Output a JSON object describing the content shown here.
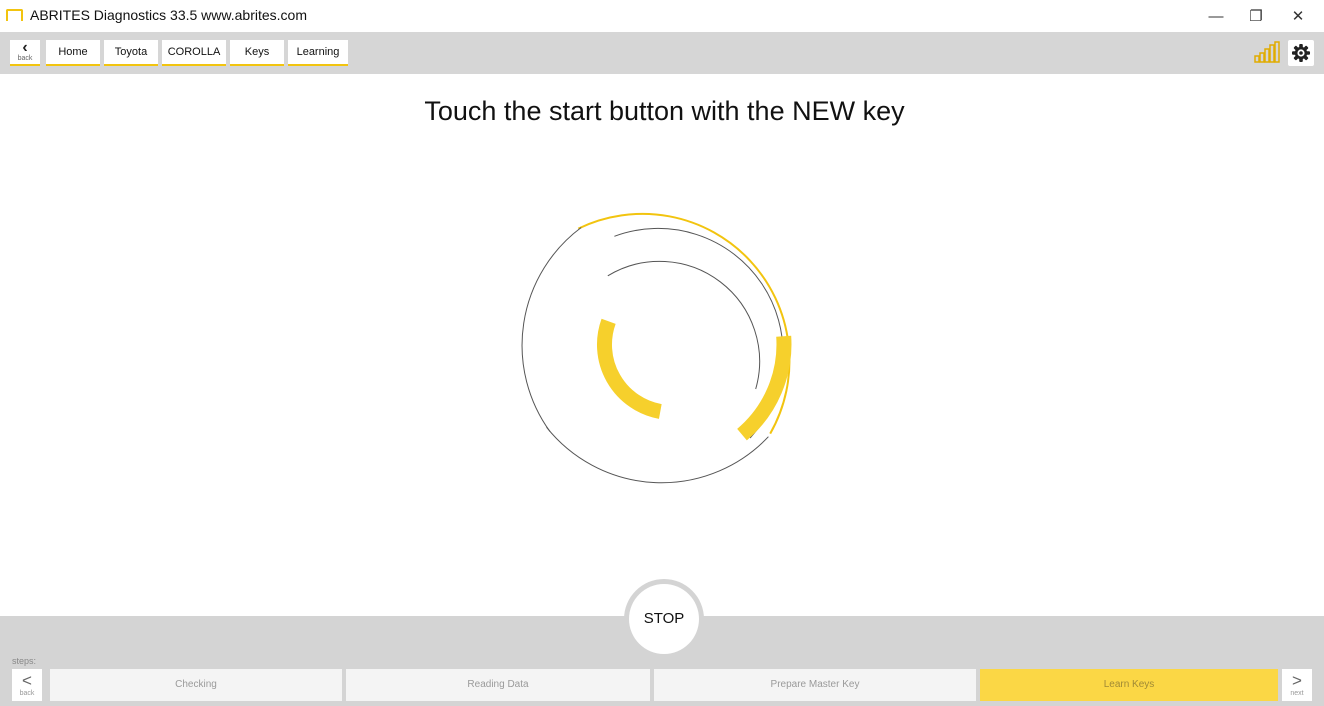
{
  "window": {
    "title": "ABRITES Diagnostics 33.5   www.abrites.com",
    "minimize": "—",
    "restore": "❐",
    "close": "✕"
  },
  "nav": {
    "back_label": "back",
    "breadcrumbs": [
      "Home",
      "Toyota",
      "COROLLA",
      "Keys",
      "Learning"
    ]
  },
  "main": {
    "instruction": "Touch the start button with the NEW key",
    "stop_label": "STOP"
  },
  "steps": {
    "label": "steps:",
    "back_label": "back",
    "next_label": "next",
    "items": [
      {
        "label": "Checking",
        "active": false
      },
      {
        "label": "Reading Data",
        "active": false
      },
      {
        "label": "Prepare Master Key",
        "active": false
      },
      {
        "label": "Learn Keys",
        "active": true
      }
    ]
  },
  "icons": [
    "app-logo-icon",
    "signal-strength-icon",
    "gear-icon",
    "chevron-left-icon",
    "chevron-right-icon"
  ],
  "colors": {
    "accent": "#f2c40f",
    "accent_fill": "#fbd745",
    "bar_gray": "#d6d6d6"
  }
}
